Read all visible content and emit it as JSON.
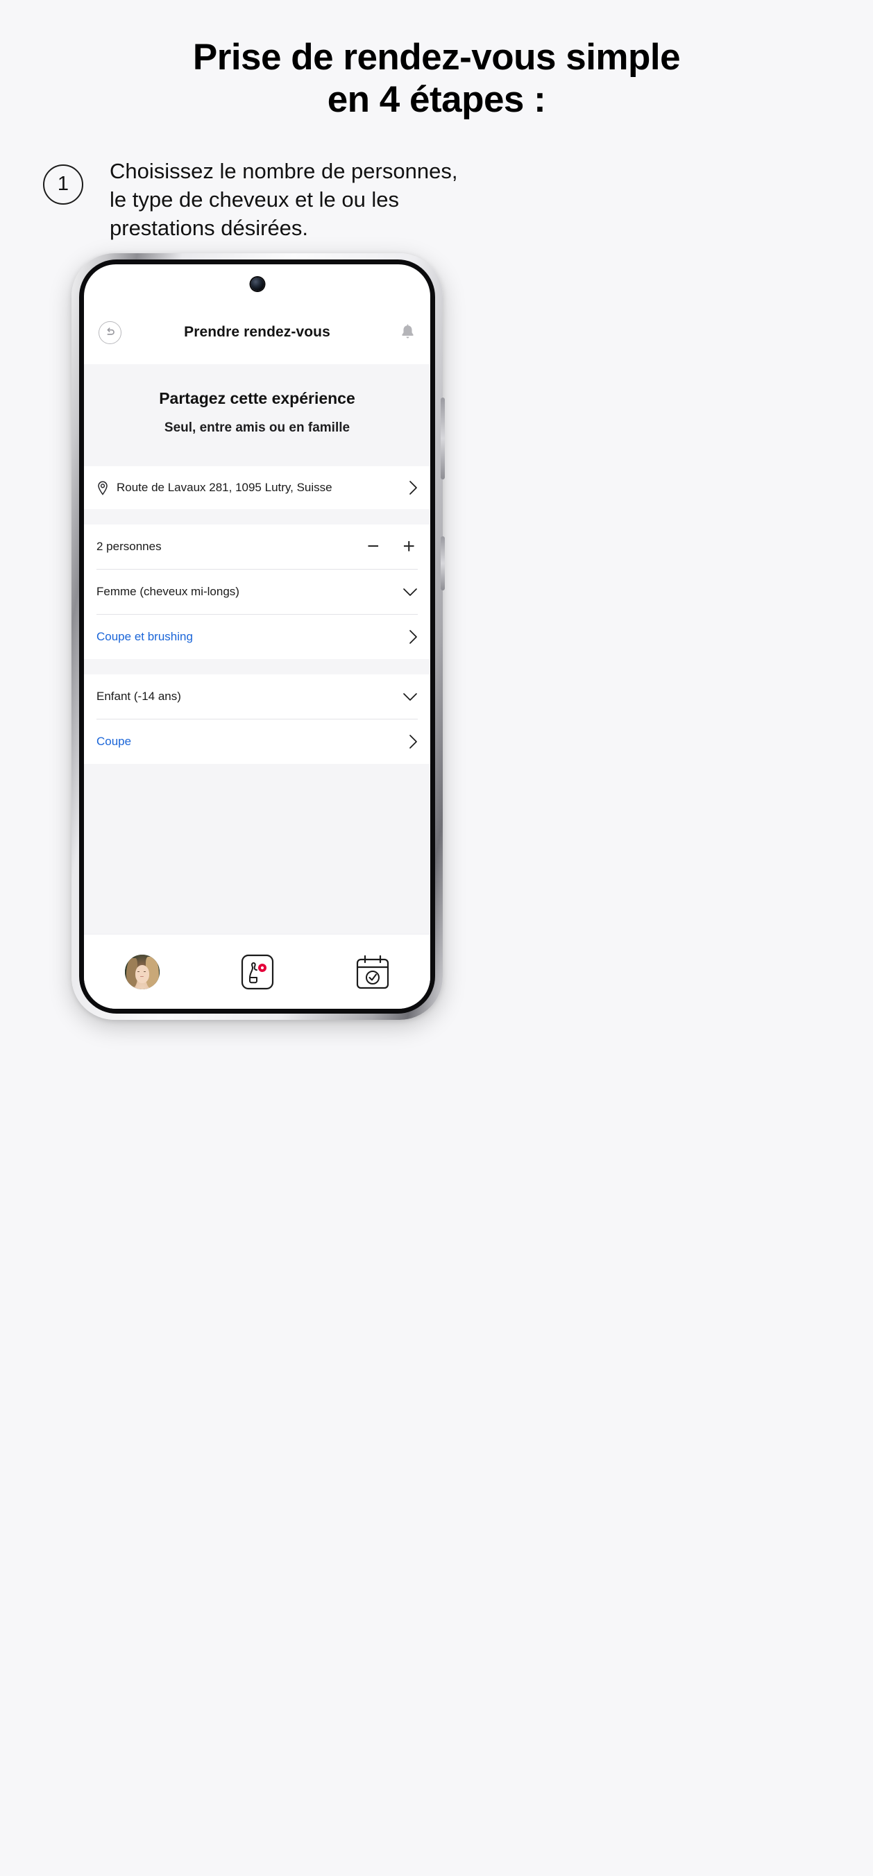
{
  "headline": {
    "line1": "Prise de rendez-vous simple",
    "line2": "en 4 étapes :"
  },
  "step": {
    "number": "1",
    "text": "Choisissez le nombre de personnes, le type de cheveux et le ou les prestations désirées."
  },
  "phone_app": {
    "header": {
      "back_icon": "back-arrow-circle-icon",
      "title": "Prendre rendez-vous",
      "bell_icon": "bell-icon"
    },
    "promo": {
      "title": "Partagez cette expérience",
      "subtitle": "Seul, entre amis ou en famille"
    },
    "address_row": {
      "pin_icon": "location-pin-icon",
      "text": "Route de Lavaux 281, 1095 Lutry, Suisse",
      "chevron_icon": "chevron-right-icon"
    },
    "counter_row": {
      "label": "2 personnes",
      "minus_label": "−",
      "plus_label": "+"
    },
    "entries": [
      {
        "person_label": "Femme (cheveux mi-longs)",
        "person_chevron": "chevron-down-icon",
        "service_label": "Coupe et brushing",
        "service_chevron": "chevron-right-icon"
      },
      {
        "person_label": "Enfant (-14 ans)",
        "person_chevron": "chevron-down-icon",
        "service_label": "Coupe",
        "service_chevron": "chevron-right-icon"
      }
    ],
    "bottom_nav": [
      {
        "icon": "avatar-profile-icon"
      },
      {
        "icon": "product-hand-icon"
      },
      {
        "icon": "calendar-check-icon"
      }
    ]
  },
  "colors": {
    "page_bg": "#f7f7f9",
    "link_blue": "#1a65d8",
    "text_dark": "#111111",
    "band_gray": "#f5f5f7"
  }
}
